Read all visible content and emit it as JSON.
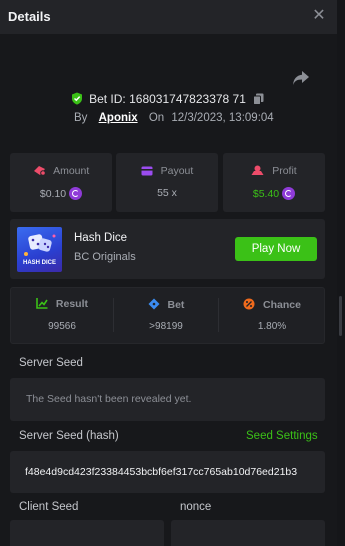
{
  "header": {
    "title": "Details",
    "close_glyph": "✕"
  },
  "bet": {
    "id_label": "Bet ID:",
    "id": "168031747823378 71",
    "by_label": "By",
    "user": "Aponix",
    "on_label": "On",
    "date": "12/3/2023, 13:09:04"
  },
  "stats": [
    {
      "label": "Amount",
      "value": "$0.10",
      "icon": "money-icon",
      "color": "#ed4c6a"
    },
    {
      "label": "Payout",
      "value": "55 x",
      "icon": "card-icon",
      "color": "#9b4cf0"
    },
    {
      "label": "Profit",
      "value": "$5.40",
      "icon": "profit-icon",
      "color": "#ed4c6a",
      "value_color": "#3bc117"
    }
  ],
  "game": {
    "name": "Hash Dice",
    "provider": "BC Originals",
    "thumb_label": "HASH DICE",
    "play_label": "Play Now"
  },
  "result": [
    {
      "label": "Result",
      "value": "99566",
      "icon": "chart-icon",
      "color": "#3bc117"
    },
    {
      "label": "Bet",
      "value": ">98199",
      "icon": "dice-icon",
      "color": "#3b8bf0"
    },
    {
      "label": "Chance",
      "value": "1.80%",
      "icon": "percent-icon",
      "color": "#f06a1c"
    }
  ],
  "server_seed": {
    "label": "Server Seed",
    "text": "The Seed hasn't been revealed yet."
  },
  "server_seed_hash": {
    "label": "Server Seed (hash)",
    "settings_label": "Seed Settings",
    "value": "f48e4d9cd423f23384453bcbf6ef317cc765ab10d76ed21b3"
  },
  "client_seed": {
    "label": "Client Seed"
  },
  "nonce": {
    "label": "nonce"
  }
}
